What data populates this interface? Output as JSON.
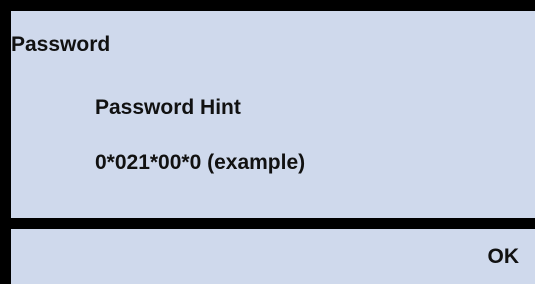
{
  "dialog": {
    "title": "Password",
    "hint_label": "Password Hint",
    "hint_value": "0*021*00*0 (example)"
  },
  "footer": {
    "ok_label": "OK"
  },
  "colors": {
    "background": "#cfd9ec",
    "border": "#000000",
    "text": "#111111"
  }
}
